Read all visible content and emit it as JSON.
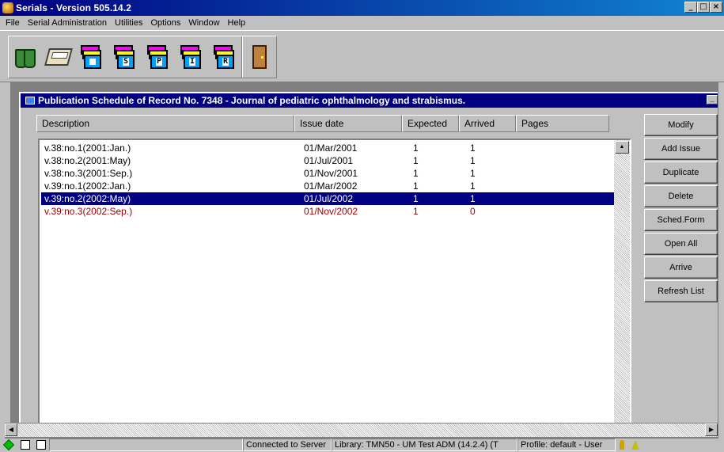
{
  "window": {
    "title": "Serials - Version 505.14.2",
    "min_label": "_",
    "max_label": "□",
    "close_label": "×"
  },
  "menu": [
    "File",
    "Serial Administration",
    "Utilities",
    "Options",
    "Window",
    "Help"
  ],
  "toolbar": {
    "icons": [
      "binoculars-icon",
      "card-tray-icon",
      "schedule-doc-icon",
      "doc-s-icon",
      "doc-p-icon",
      "doc-i-icon",
      "doc-r-icon",
      "exit-door-icon"
    ],
    "doc_letters": [
      "S",
      "P",
      "I",
      "R"
    ]
  },
  "subwindow": {
    "title": "Publication Schedule of Record No. 7348 - Journal of pediatric ophthalmology and strabismus."
  },
  "table": {
    "headers": [
      "Description",
      "Issue date",
      "Expected",
      "Arrived",
      "Pages"
    ],
    "rows": [
      {
        "description": "v.38:no.1(2001:Jan.)",
        "issue_date": "01/Mar/2001",
        "expected": "1",
        "arrived": "1",
        "state": "normal"
      },
      {
        "description": "v.38:no.2(2001:May)",
        "issue_date": "01/Jul/2001",
        "expected": "1",
        "arrived": "1",
        "state": "normal"
      },
      {
        "description": "v.38:no.3(2001:Sep.)",
        "issue_date": "01/Nov/2001",
        "expected": "1",
        "arrived": "1",
        "state": "normal"
      },
      {
        "description": "v.39:no.1(2002:Jan.)",
        "issue_date": "01/Mar/2002",
        "expected": "1",
        "arrived": "1",
        "state": "normal"
      },
      {
        "description": "v.39:no.2(2002:May)",
        "issue_date": "01/Jul/2002",
        "expected": "1",
        "arrived": "1",
        "state": "selected"
      },
      {
        "description": "v.39:no.3(2002:Sep.)",
        "issue_date": "01/Nov/2002",
        "expected": "1",
        "arrived": "0",
        "state": "pending"
      }
    ]
  },
  "buttons": [
    "Modify",
    "Add Issue",
    "Duplicate",
    "Delete",
    "Sched.Form",
    "Open All",
    "Arrive",
    "Refresh List"
  ],
  "status": {
    "connection": "Connected to Server",
    "library": "Library:  TMN50 - UM Test ADM (14.2.4) (T",
    "profile": "Profile: default - User"
  },
  "colors": {
    "title_bar": "#000080",
    "selection": "#000080",
    "pending_row": "#a00000",
    "face": "#c0c0c0"
  }
}
